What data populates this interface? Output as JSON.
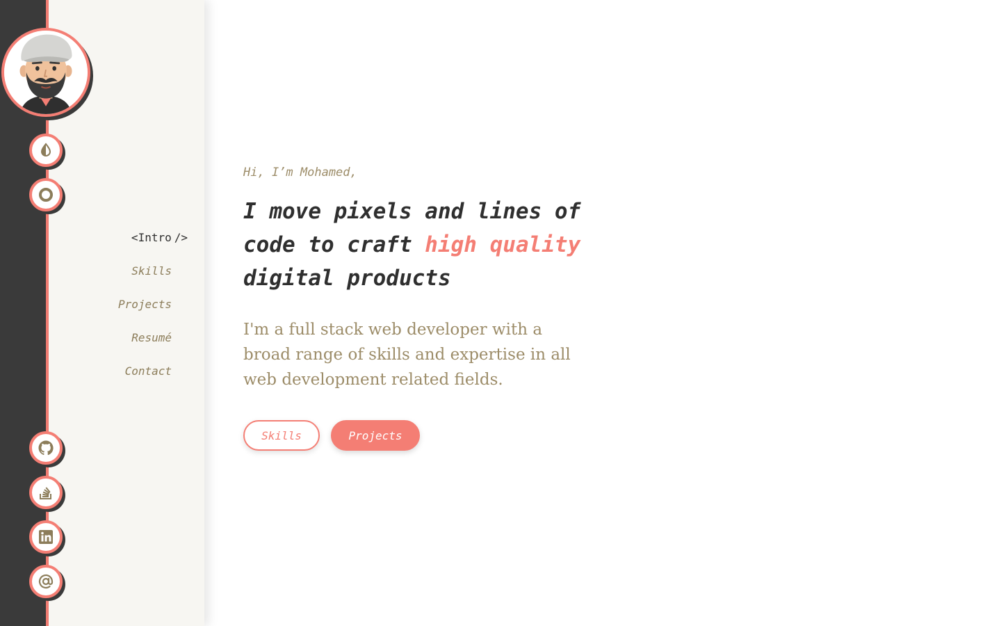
{
  "colors": {
    "accent": "#f47e74",
    "dark": "#3a3a3a",
    "muted": "#9c8c68",
    "sidebar": "#f7f6f2",
    "text": "#2f2f2f"
  },
  "avatar": {
    "icon": "avatar-cartoon-icon"
  },
  "theme_controls": [
    {
      "icon": "contrast-icon"
    },
    {
      "icon": "ring-icon"
    }
  ],
  "nav": {
    "items": [
      {
        "label": "Intro",
        "active": true,
        "prefix": "<",
        "suffix": "/>"
      },
      {
        "label": "Skills"
      },
      {
        "label": "Projects"
      },
      {
        "label": "Resumé"
      },
      {
        "label": "Contact"
      }
    ]
  },
  "social": [
    {
      "icon": "github-icon"
    },
    {
      "icon": "stackoverflow-icon"
    },
    {
      "icon": "linkedin-icon"
    },
    {
      "icon": "at-sign-icon"
    }
  ],
  "hero": {
    "greeting": "Hi, I’m Mohamed,",
    "headline_before": "I move pixels and lines of code to craft ",
    "headline_highlight": "high quality",
    "headline_after": " digital products",
    "intro": "I'm a full stack web developer with a broad range of skills and expertise in all web development related fields.",
    "buttons": {
      "secondary": "Skills",
      "primary": "Projects"
    }
  }
}
